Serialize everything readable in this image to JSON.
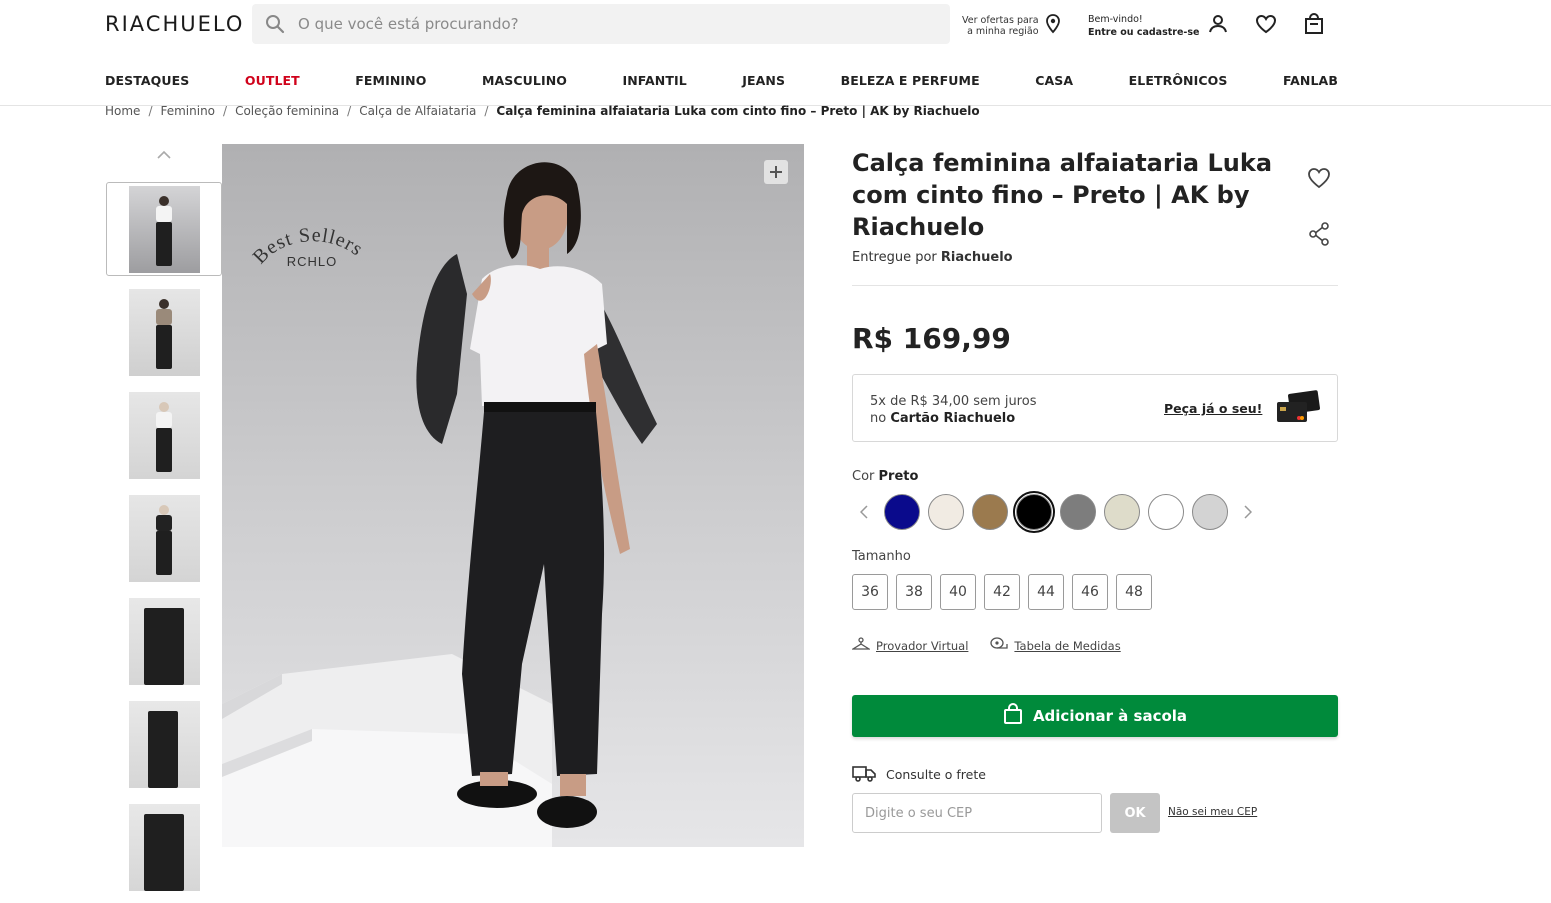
{
  "header": {
    "logo": "RIACHUELO",
    "search_placeholder": "O que você está procurando?",
    "region_line1": "Ver ofertas para",
    "region_line2": "a minha região",
    "welcome_line1": "Bem-vindo!",
    "welcome_line2": "Entre ou cadastre-se"
  },
  "nav": [
    "DESTAQUES",
    "OUTLET",
    "FEMININO",
    "MASCULINO",
    "INFANTIL",
    "JEANS",
    "BELEZA E PERFUME",
    "CASA",
    "ELETRÔNICOS",
    "FANLAB"
  ],
  "breadcrumb": {
    "items": [
      "Home",
      "Feminino",
      "Coleção feminina",
      "Calça de Alfaiataria"
    ],
    "current": "Calça feminina alfaiataria Luka com cinto fino – Preto | AK by Riachuelo",
    "separator": "/"
  },
  "gallery": {
    "badge_line1": "Best Sellers",
    "badge_line2": "RCHLO",
    "thumb_count": 7,
    "active_thumb": 1
  },
  "product": {
    "title": "Calça feminina alfaiataria Luka com cinto fino – Preto | AK by Riachuelo",
    "seller_prefix": "Entregue por",
    "seller": "Riachuelo",
    "price": "R$ 169,99",
    "installments_line1": "5x de R$ 34,00 sem juros",
    "installments_prefix": "no",
    "installments_card": "Cartão Riachuelo",
    "installments_cta": "Peça já o seu!",
    "color_label": "Cor",
    "color_selected": "Preto",
    "colors": [
      {
        "name": "azul-marinho",
        "hex": "#0a0a8c"
      },
      {
        "name": "off-white",
        "hex": "#f1ebe3"
      },
      {
        "name": "caramelo",
        "hex": "#9b7a4e"
      },
      {
        "name": "preto",
        "hex": "#000000",
        "selected": true
      },
      {
        "name": "cinza",
        "hex": "#7d7d7d"
      },
      {
        "name": "bege",
        "hex": "#dedcca"
      },
      {
        "name": "branco",
        "hex": "#ffffff"
      },
      {
        "name": "cinza-claro",
        "hex": "#d3d3d3"
      }
    ],
    "size_label": "Tamanho",
    "sizes": [
      "36",
      "38",
      "40",
      "42",
      "44",
      "46",
      "48"
    ],
    "provador": "Provador Virtual",
    "tabela": "Tabela de Medidas",
    "add_to_bag": "Adicionar à sacola",
    "frete_label": "Consulte o frete",
    "cep_placeholder": "Digite o seu CEP",
    "ok": "OK",
    "nao_sei_cep": "Não sei meu CEP"
  },
  "colors": {
    "primary_green": "#008a3b",
    "outlet_red": "#d0021b"
  }
}
